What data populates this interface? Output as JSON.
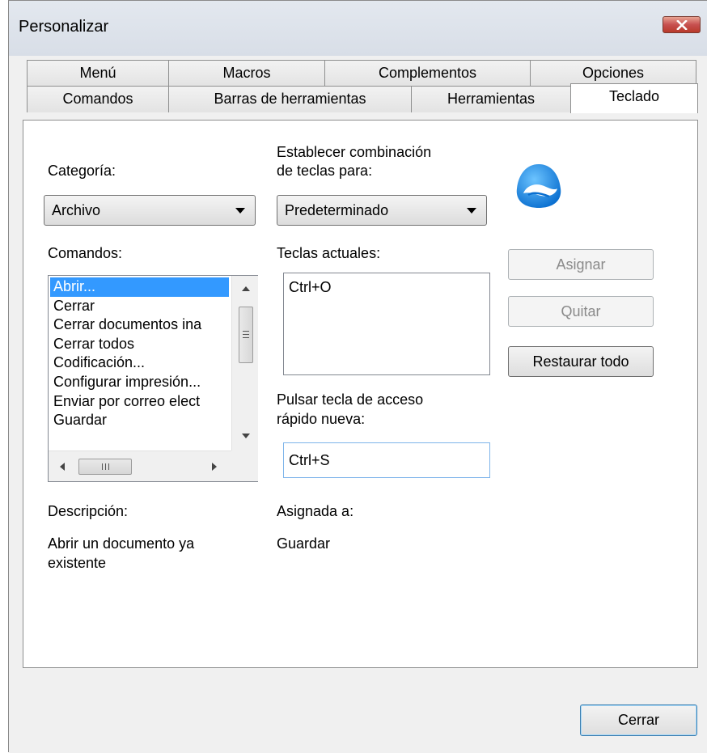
{
  "window": {
    "title": "Personalizar"
  },
  "tabs": {
    "row1": [
      "Menú",
      "Macros",
      "Complementos",
      "Opciones"
    ],
    "row2": [
      "Comandos",
      "Barras de herramientas",
      "Herramientas",
      "Teclado"
    ],
    "active": "Teclado"
  },
  "category": {
    "label": "Categoría:",
    "value": "Archivo"
  },
  "key_combo": {
    "label_line1": "Establecer combinación",
    "label_line2": "de teclas para:",
    "value": "Predeterminado"
  },
  "commands": {
    "label": "Comandos:",
    "items": [
      "Abrir...",
      "Cerrar",
      "Cerrar documentos ina",
      "Cerrar todos",
      "Codificación...",
      "Configurar impresión...",
      "Enviar por correo elect",
      "Guardar"
    ],
    "selected_index": 0
  },
  "current_keys": {
    "label": "Teclas actuales:",
    "items": [
      "Ctrl+O"
    ]
  },
  "new_shortcut": {
    "label_line1": "Pulsar tecla de acceso",
    "label_line2": "rápido nueva:",
    "value": "Ctrl+S"
  },
  "buttons": {
    "assign": "Asignar",
    "remove": "Quitar",
    "reset_all": "Restaurar todo",
    "close": "Cerrar"
  },
  "description": {
    "label": "Descripción:",
    "line1": "Abrir un documento ya",
    "line2": "existente"
  },
  "assigned_to": {
    "label": "Asignada a:",
    "value": "Guardar"
  },
  "colors": {
    "selection": "#3399ff",
    "close_button": "#c75050",
    "logo": "#1e88e5"
  },
  "icons": {
    "close": "close-x-icon",
    "logo": "app-logo-icon",
    "dropdown": "chevron-down-icon"
  }
}
